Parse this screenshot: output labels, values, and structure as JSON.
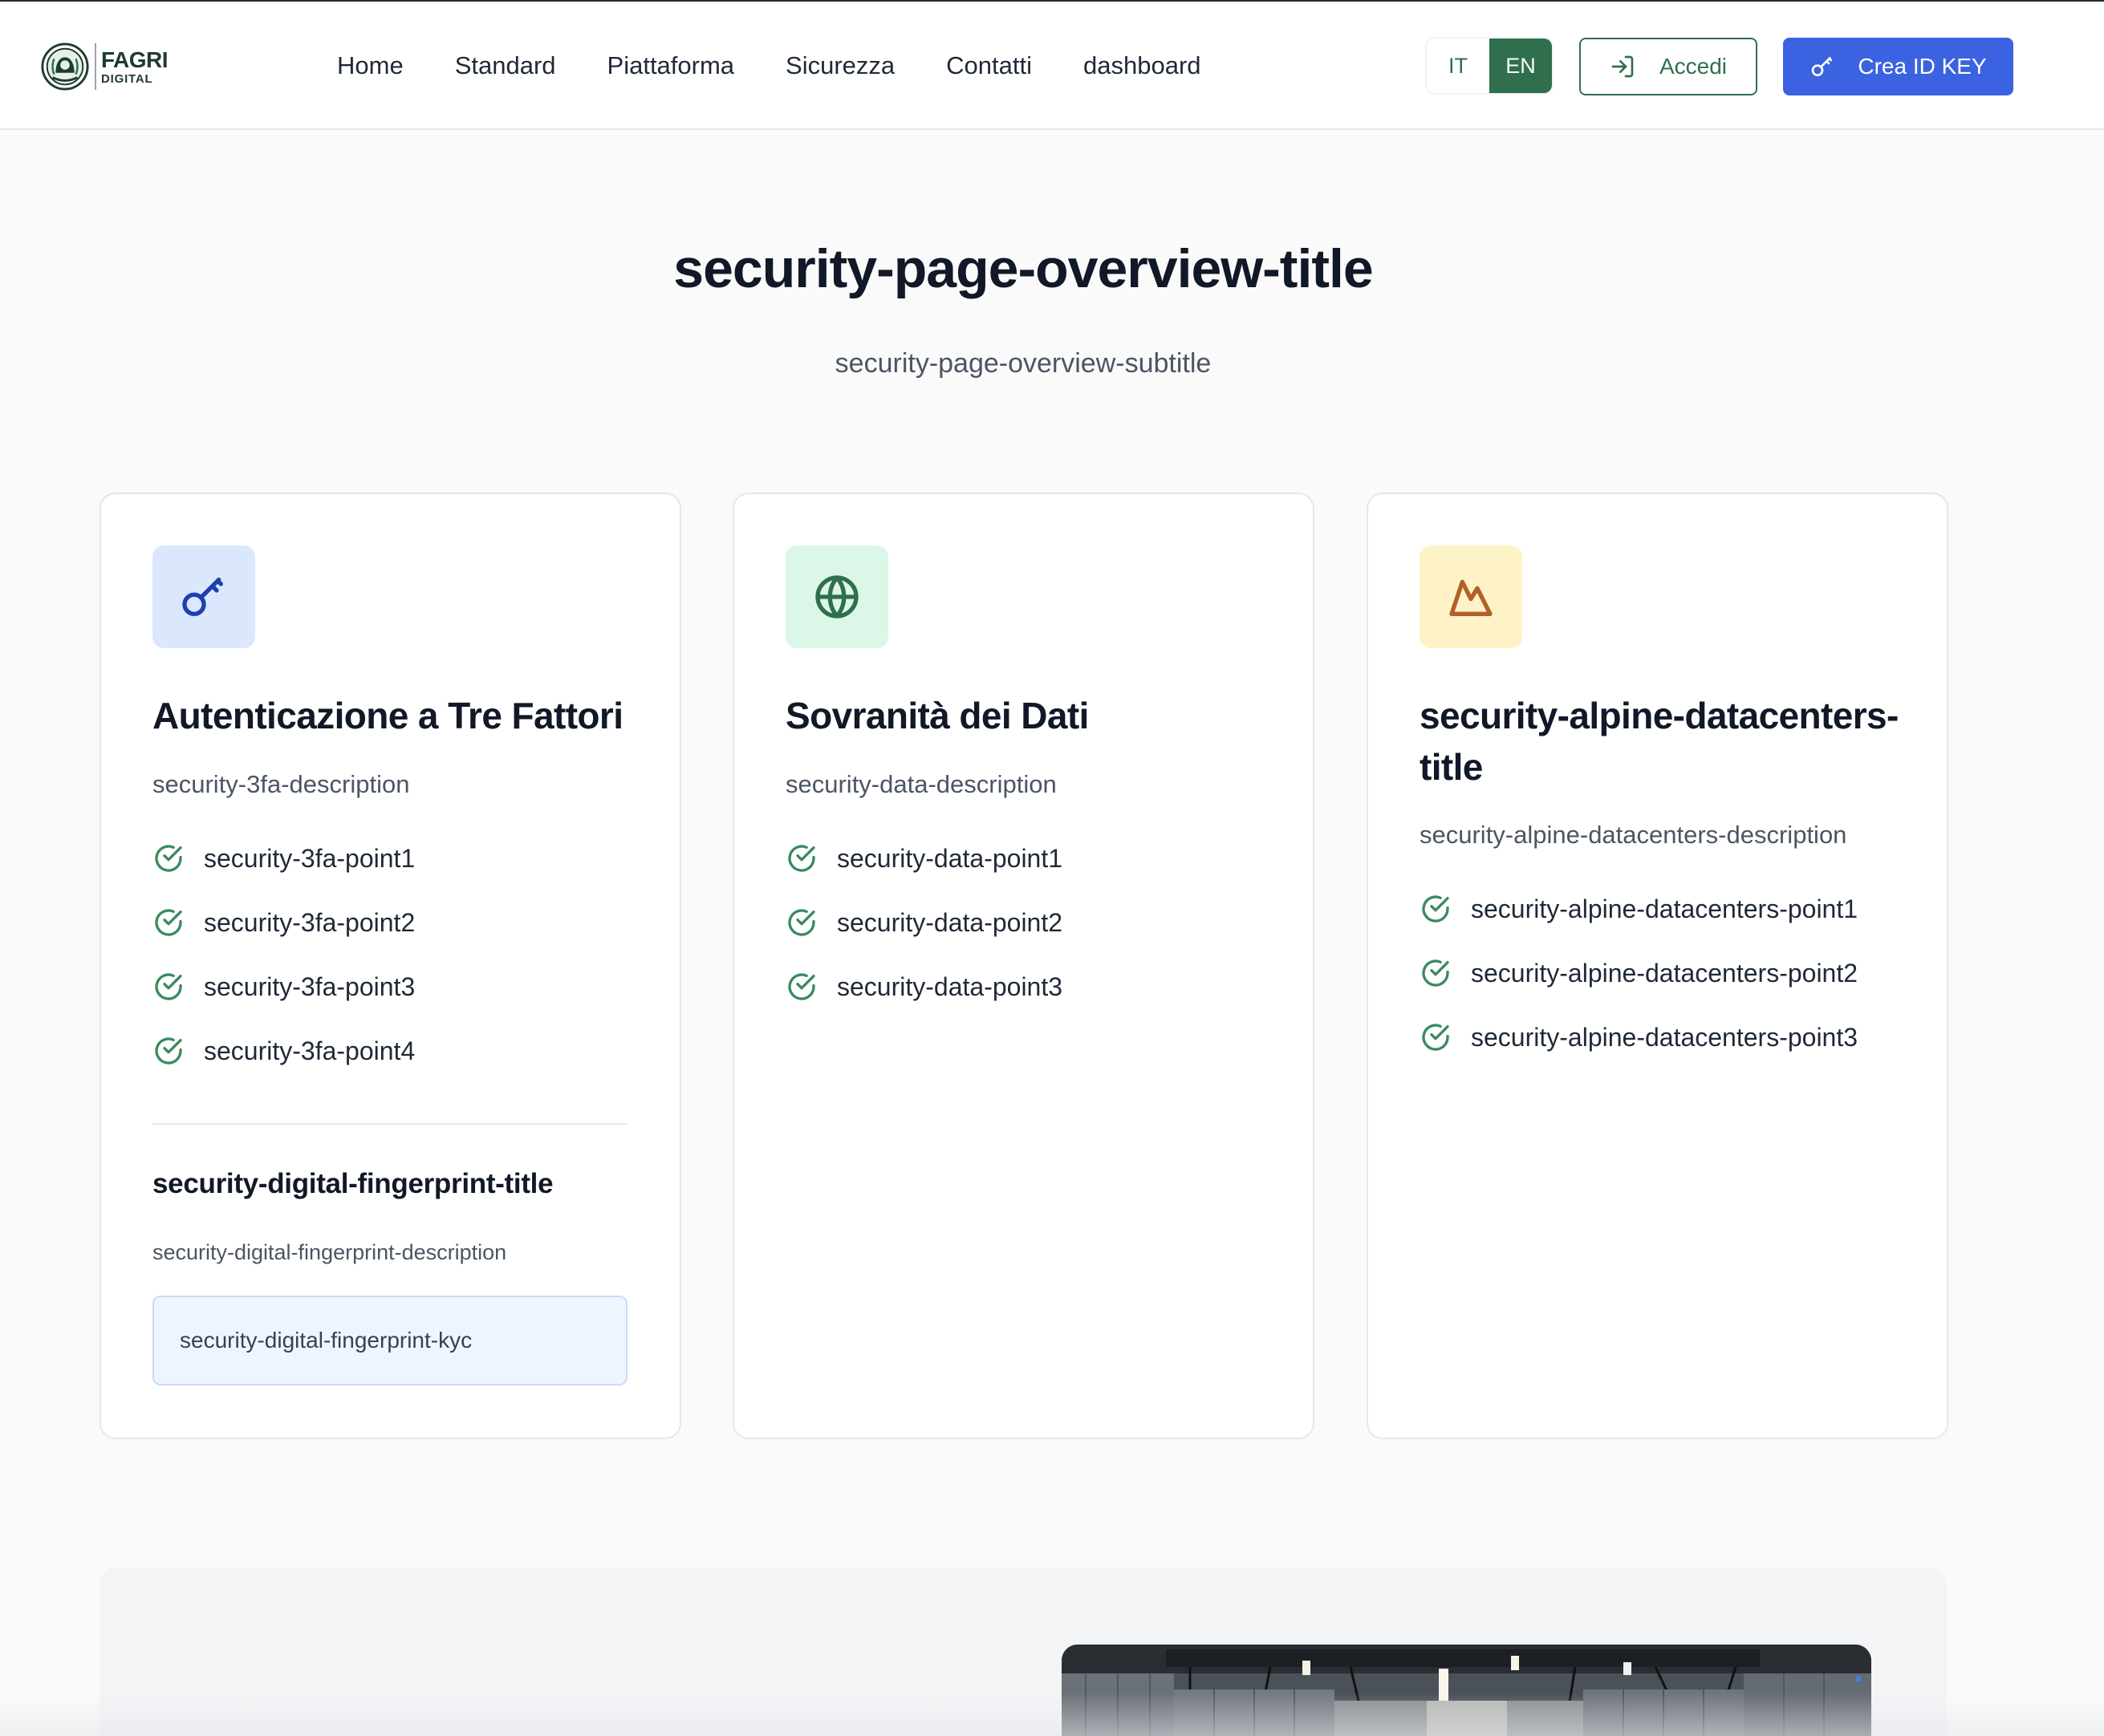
{
  "header": {
    "logo": {
      "line1": "FAGRI",
      "line2": "DIGITAL"
    },
    "nav": [
      "Home",
      "Standard",
      "Piattaforma",
      "Sicurezza",
      "Contatti",
      "dashboard"
    ],
    "lang": {
      "it": "IT",
      "en": "EN",
      "active": "EN"
    },
    "login_label": "Accedi",
    "create_label": "Crea ID KEY"
  },
  "overview": {
    "title": "security-page-overview-title",
    "subtitle": "security-page-overview-subtitle"
  },
  "cards": [
    {
      "icon": "key-icon",
      "title": "Autenticazione a Tre Fattori",
      "description": "security-3fa-description",
      "points": [
        "security-3fa-point1",
        "security-3fa-point2",
        "security-3fa-point3",
        "security-3fa-point4"
      ],
      "fingerprint": {
        "title": "security-digital-fingerprint-title",
        "description": "security-digital-fingerprint-description",
        "kyc": "security-digital-fingerprint-kyc"
      }
    },
    {
      "icon": "globe-icon",
      "title": "Sovranità dei Dati",
      "description": "security-data-description",
      "points": [
        "security-data-point1",
        "security-data-point2",
        "security-data-point3"
      ]
    },
    {
      "icon": "mountain-icon",
      "title": "security-alpine-datacenters-title",
      "description": "security-alpine-datacenters-description",
      "points": [
        "security-alpine-datacenters-point1",
        "security-alpine-datacenters-point2",
        "security-alpine-datacenters-point3"
      ]
    }
  ],
  "colors": {
    "brand_green": "#2f6f4e",
    "primary_blue": "#3b62e0",
    "check_green": "#3a8a5f"
  }
}
